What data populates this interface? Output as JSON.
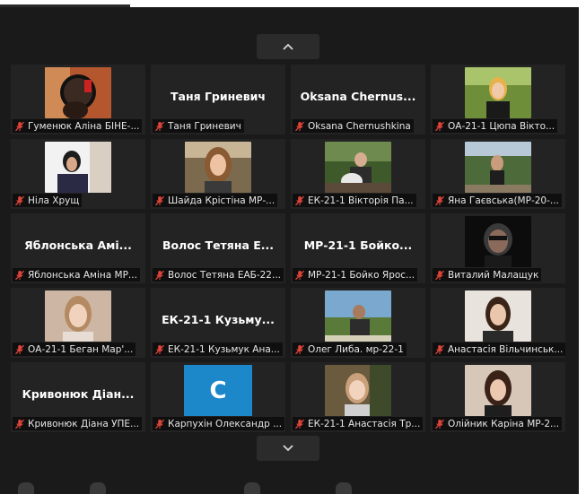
{
  "nav": {
    "page_up_icon": "chevron-up-icon",
    "page_down_icon": "chevron-down-icon"
  },
  "colors": {
    "background": "#1a1a1a",
    "tile": "#232323",
    "muted_icon": "#e0453a",
    "avatar_blue": "#1c87c9"
  },
  "participants": [
    {
      "display": "video",
      "label": "Гуменюк Аліна БІНЕ-..."
    },
    {
      "display": "name",
      "big_name": "Таня Гриневич",
      "label": "Таня Гриневич"
    },
    {
      "display": "name",
      "big_name": "Oksana Chernus...",
      "label": "Oksana Chernushkina"
    },
    {
      "display": "video",
      "label": "ОА-21-1 Цюпа Вікто..."
    },
    {
      "display": "video",
      "label": "Ніла Хрущ"
    },
    {
      "display": "video",
      "label": "Шайда Крістіна МР-..."
    },
    {
      "display": "video",
      "label": "ЕК-21-1 Вікторія Па..."
    },
    {
      "display": "video",
      "label": "Яна Гаєвська(МР-20-..."
    },
    {
      "display": "name",
      "big_name": "Яблонська Амі...",
      "label": "Яблонська Аміна МР..."
    },
    {
      "display": "name",
      "big_name": "Волос Тетяна Е...",
      "label": "Волос Тетяна ЕАБ-22..."
    },
    {
      "display": "name",
      "big_name": "МР-21-1 Бойко...",
      "label": "МР-21-1 Бойко Ярос..."
    },
    {
      "display": "video",
      "label": "Виталий Малащук"
    },
    {
      "display": "video",
      "label": "ОА-21-1 Беган Мар'..."
    },
    {
      "display": "name",
      "big_name": "ЕК-21-1 Кузьму...",
      "label": "ЕК-21-1 Кузьмук Ана..."
    },
    {
      "display": "video",
      "label": "Олег Либа. мр-22-1"
    },
    {
      "display": "video",
      "label": "Анастасія Вільчинськ..."
    },
    {
      "display": "name",
      "big_name": "Кривонюк Діан...",
      "label": "Кривонюк Діана УПЕ..."
    },
    {
      "display": "avatar",
      "avatar_letter": "C",
      "label": "Карпухін Олександр ..."
    },
    {
      "display": "video",
      "label": "ЕК-21-1 Анастасія Тр..."
    },
    {
      "display": "video",
      "label": "Олійник Каріна МР-2..."
    }
  ]
}
